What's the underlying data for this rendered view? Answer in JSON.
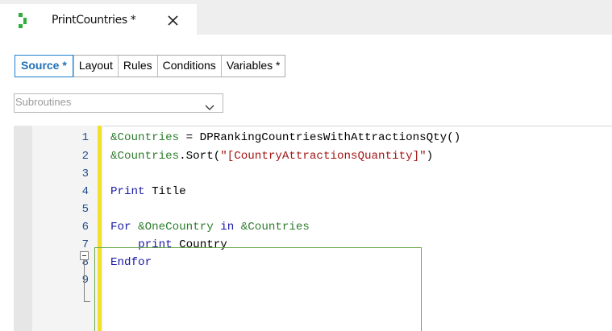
{
  "document_tab": {
    "title": "PrintCountries *",
    "icon": "object-icon",
    "close_icon": "close-icon"
  },
  "sub_tabs": [
    {
      "label": "Source *",
      "active": true
    },
    {
      "label": "Layout"
    },
    {
      "label": "Rules"
    },
    {
      "label": "Conditions"
    },
    {
      "label": "Variables *"
    }
  ],
  "subroutines_dropdown": {
    "value": "Subroutines"
  },
  "editor": {
    "lines": [
      {
        "num": "1",
        "text": "&Countries = DPRankingCountriesWithAttractionsQty()"
      },
      {
        "num": "2",
        "text": "&Countries.Sort(\"[CountryAttractionsQuantity]\")"
      },
      {
        "num": "3",
        "text": ""
      },
      {
        "num": "4",
        "text": "Print Title"
      },
      {
        "num": "5",
        "text": ""
      },
      {
        "num": "6",
        "text": "For &OneCountry in &Countries"
      },
      {
        "num": "7",
        "text": "    print Country"
      },
      {
        "num": "8",
        "text": "Endfor"
      },
      {
        "num": "9",
        "text": ""
      }
    ]
  },
  "colors": {
    "keyword": "#1a1aa6",
    "variable": "#2e7d2e",
    "string": "#a31515",
    "active_tab": "#1f6fb6",
    "change_bar": "#f0df2b"
  }
}
